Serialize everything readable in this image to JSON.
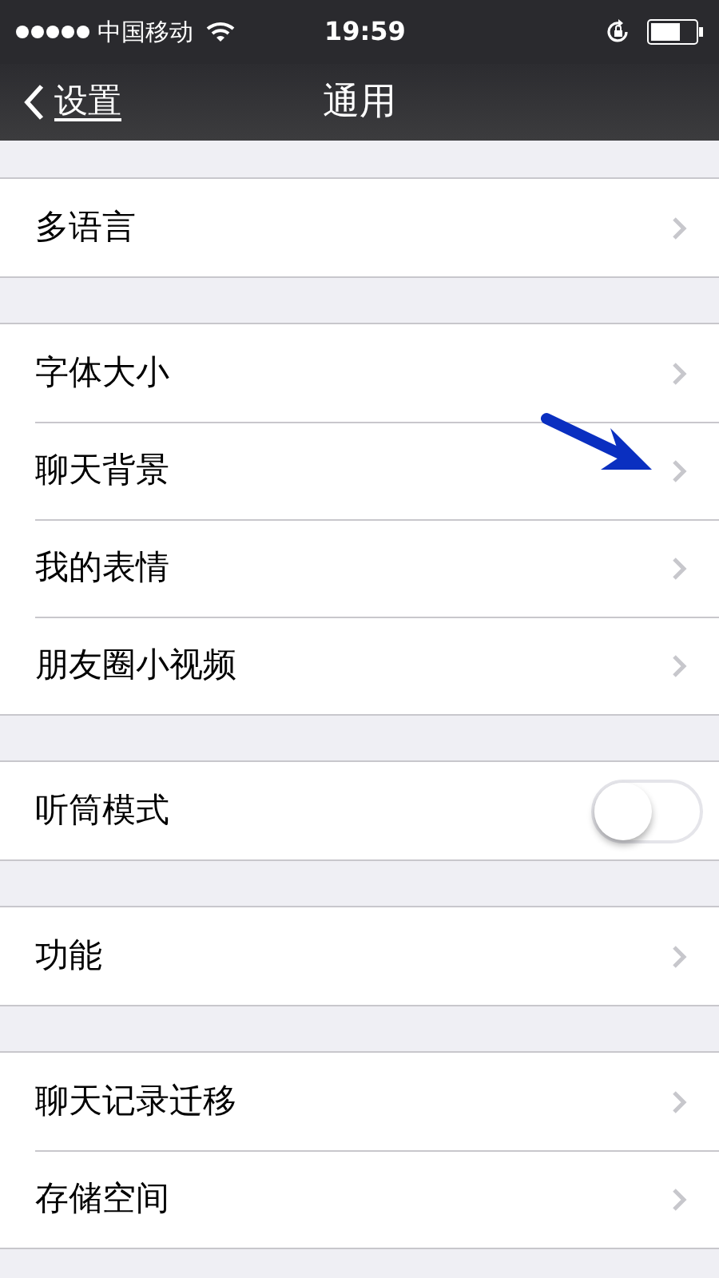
{
  "status_bar": {
    "carrier": "中国移动",
    "time": "19:59"
  },
  "nav": {
    "back_label": "设置",
    "title": "通用"
  },
  "groups": [
    {
      "rows": [
        {
          "kind": "link",
          "label": "多语言"
        }
      ]
    },
    {
      "rows": [
        {
          "kind": "link",
          "label": "字体大小"
        },
        {
          "kind": "link",
          "label": "聊天背景"
        },
        {
          "kind": "link",
          "label": "我的表情"
        },
        {
          "kind": "link",
          "label": "朋友圈小视频"
        }
      ]
    },
    {
      "rows": [
        {
          "kind": "toggle",
          "label": "听筒模式",
          "on": false
        }
      ]
    },
    {
      "rows": [
        {
          "kind": "link",
          "label": "功能"
        }
      ]
    },
    {
      "rows": [
        {
          "kind": "link",
          "label": "聊天记录迁移"
        },
        {
          "kind": "link",
          "label": "存储空间"
        }
      ]
    }
  ]
}
